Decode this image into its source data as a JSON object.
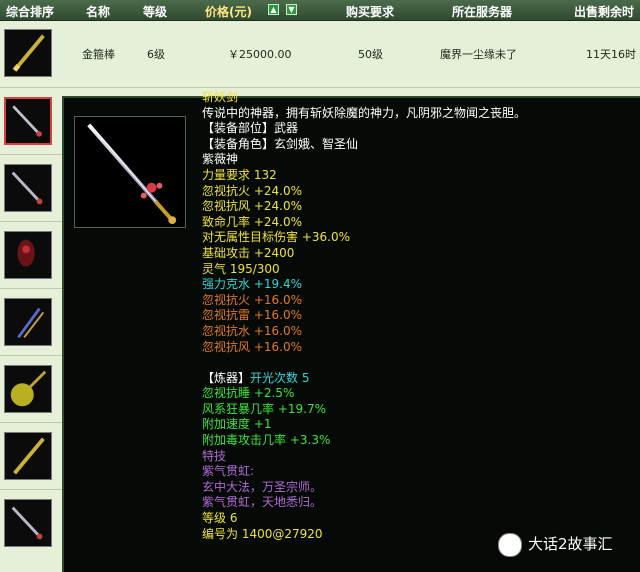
{
  "header": {
    "col_sort": "综合排序",
    "col_name": "名称",
    "col_level": "等级",
    "col_price": "价格(元)",
    "col_req": "购买要求",
    "col_server": "所在服务器",
    "col_time": "出售剩余时"
  },
  "first_row": {
    "name": "金箍棒",
    "level": "6级",
    "price": "￥25000.00",
    "req": "50级",
    "server": "魔界一尘缘未了",
    "time": "11天16时"
  },
  "side_stub": "时",
  "tooltip": {
    "lines": [
      {
        "text": "斩妖剑",
        "color": "y"
      },
      {
        "text": "传说中的神器，拥有斩妖除魔的神力，凡阴邪之物闻之丧胆。",
        "color": "w"
      },
      {
        "text": "【装备部位】武器",
        "color": "w"
      },
      {
        "text": "【装备角色】玄剑娥、智圣仙",
        "color": "w"
      },
      {
        "text": "紫薇神",
        "color": "w"
      },
      {
        "text": "力量要求 132",
        "color": "y"
      },
      {
        "text": "忽视抗火 +24.0%",
        "color": "y"
      },
      {
        "text": "忽视抗风 +24.0%",
        "color": "y"
      },
      {
        "text": "致命几率 +24.0%",
        "color": "y"
      },
      {
        "text": "对无属性目标伤害 +36.0%",
        "color": "y"
      },
      {
        "text": "基础攻击 +2400",
        "color": "y"
      },
      {
        "text": "灵气 195/300",
        "color": "y"
      },
      {
        "text": "强力克水 +19.4%",
        "color": "c"
      },
      {
        "text": "忽视抗火 +16.0%",
        "color": "o"
      },
      {
        "text": "忽视抗雷 +16.0%",
        "color": "o"
      },
      {
        "text": "忽视抗水 +16.0%",
        "color": "o"
      },
      {
        "text": "忽视抗风 +16.0%",
        "color": "o"
      },
      {
        "text": "",
        "color": "blank"
      },
      {
        "text": "【炼器】",
        "color": "w",
        "extra": "开光次数 5",
        "extra_color": "c"
      },
      {
        "text": "忽视抗睡 +2.5%",
        "color": "g"
      },
      {
        "text": "风系狂暴几率 +19.7%",
        "color": "g"
      },
      {
        "text": "附加速度 +1",
        "color": "g"
      },
      {
        "text": "附加毒攻击几率 +3.3%",
        "color": "g"
      },
      {
        "text": "特技",
        "color": "p"
      },
      {
        "text": "紫气贯虹:",
        "color": "p"
      },
      {
        "text": "玄中大法，万圣宗师。",
        "color": "p"
      },
      {
        "text": "紫气贯虹，天地悉归。",
        "color": "p"
      },
      {
        "text": "等级 6",
        "color": "y"
      },
      {
        "text": "编号为 1400@27920",
        "color": "y"
      }
    ]
  },
  "watermark": "大话2故事汇"
}
